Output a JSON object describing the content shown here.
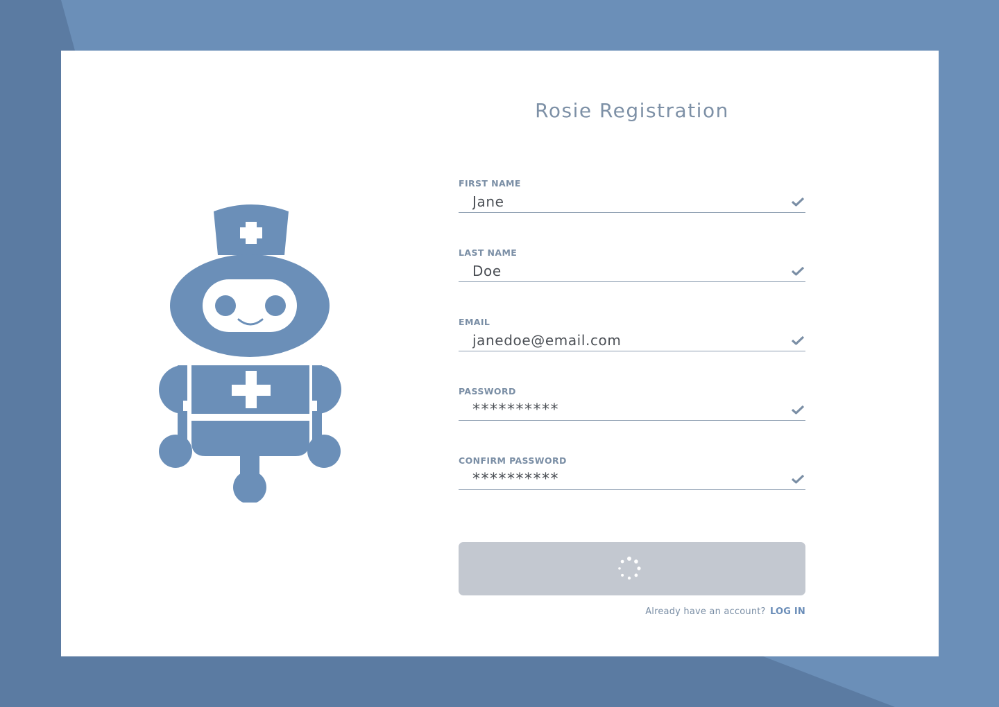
{
  "page": {
    "title": "Rosie Registration"
  },
  "colors": {
    "background": "#5b7ba2",
    "background_accent": "#6b8fb8",
    "card": "#ffffff",
    "robot": "#6b8fb8",
    "label": "#7a8ea5",
    "button_disabled": "#c3c8d0",
    "link": "#6a8db8"
  },
  "illustration": {
    "icon": "nurse-robot-icon"
  },
  "form": {
    "fields": [
      {
        "label": "FIRST NAME",
        "value": "Jane",
        "status_icon": "check-icon"
      },
      {
        "label": "LAST NAME",
        "value": "Doe",
        "status_icon": "check-icon"
      },
      {
        "label": "EMAIL",
        "value": "janedoe@email.com",
        "status_icon": "check-icon"
      },
      {
        "label": "PASSWORD",
        "value": "**********",
        "status_icon": "check-icon"
      },
      {
        "label": "CONFIRM PASSWORD",
        "value": "**********",
        "status_icon": "check-icon"
      }
    ],
    "submit": {
      "state": "loading",
      "icon": "loading-spinner-icon"
    }
  },
  "footer": {
    "prompt": "Already have an account?",
    "login_link": "LOG IN"
  }
}
